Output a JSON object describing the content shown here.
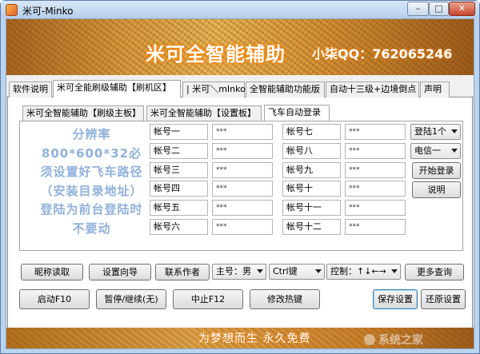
{
  "window": {
    "title": "米可-Minko",
    "minimize": "–",
    "maximize": "□",
    "close": "✕"
  },
  "banner": {
    "title": "米可全智能辅助",
    "qq": "小柒QQ：762065246"
  },
  "tabs": [
    {
      "label": "软件说明"
    },
    {
      "label": "米可全能刷级辅助【刷机区】"
    },
    {
      "label": "| 米可＼mInko"
    },
    {
      "label": "全智能辅助功能版"
    },
    {
      "label": "自动十三级+边境倒点"
    },
    {
      "label": "声明"
    }
  ],
  "subtabs": [
    {
      "label": "米可全智能辅助【刷级主板】"
    },
    {
      "label": "米可全智能辅助【设置板】"
    },
    {
      "label": "飞车自动登录"
    }
  ],
  "notice": "分辨率800*600*32必须设置好飞车路径（安装目录地址）登陆为前台登陆时不要动",
  "accounts_left": [
    {
      "name": "帐号一",
      "pw": "***"
    },
    {
      "name": "帐号二",
      "pw": "***"
    },
    {
      "name": "帐号三",
      "pw": "***"
    },
    {
      "name": "帐号四",
      "pw": "***"
    },
    {
      "name": "帐号五",
      "pw": "***"
    },
    {
      "name": "帐号六",
      "pw": "***"
    }
  ],
  "accounts_right": [
    {
      "name": "帐号七",
      "pw": "***"
    },
    {
      "name": "帐号八",
      "pw": "***"
    },
    {
      "name": "帐号九",
      "pw": "***"
    },
    {
      "name": "帐号十",
      "pw": "***"
    },
    {
      "name": "帐号十一",
      "pw": "***"
    },
    {
      "name": "帐号十二",
      "pw": "***"
    }
  ],
  "login_controls": {
    "login_count": "登陆1个",
    "server": "电信一",
    "start_login": "开始登录",
    "help": "说明"
  },
  "toolbar": {
    "read_nickname": "昵称读取",
    "setup_wizard": "设置向导",
    "contact_author": "联系作者",
    "gender": "主号：男",
    "key": "Ctrl键",
    "control": "控制：↑↓←→",
    "more_query": "更多查询"
  },
  "actions": {
    "start": "启动F10",
    "pause": "暂停/继续(无)",
    "stop": "中止F12",
    "hotkey": "修改热键",
    "save": "保存设置",
    "restore": "还原设置"
  },
  "footer": {
    "slogan": "为梦想而生  永久免费",
    "watermark": "系统之家"
  }
}
